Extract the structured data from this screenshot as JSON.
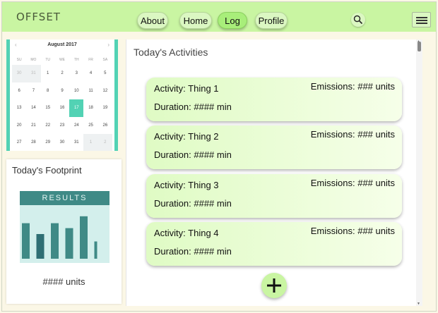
{
  "app": {
    "brand": "OFFSET"
  },
  "nav": {
    "about": "About",
    "home": "Home",
    "log": "Log",
    "profile": "Profile"
  },
  "calendar": {
    "month_label": "August 2017",
    "weekdays": [
      "SU",
      "MO",
      "TU",
      "WE",
      "TH",
      "FR",
      "SA"
    ],
    "weeks": [
      [
        "30",
        "31",
        "1",
        "2",
        "3",
        "4",
        "5"
      ],
      [
        "6",
        "7",
        "8",
        "9",
        "10",
        "11",
        "12"
      ],
      [
        "13",
        "14",
        "15",
        "16",
        "17",
        "18",
        "19"
      ],
      [
        "20",
        "21",
        "22",
        "23",
        "24",
        "25",
        "26"
      ],
      [
        "27",
        "28",
        "29",
        "30",
        "31",
        "1",
        "2"
      ]
    ],
    "selected_day": "17"
  },
  "footprint": {
    "title": "Today's Footprint",
    "results_label": "RESULTS",
    "units_label": "#### units",
    "bar_levels": [
      0.72,
      0.5,
      0.72,
      0.62,
      0.86,
      0.35
    ]
  },
  "activities": {
    "title": "Today's Activities",
    "items": [
      {
        "name": "Activity: Thing 1",
        "emissions": "Emissions: ### units",
        "duration": "Duration: #### min"
      },
      {
        "name": "Activity: Thing 2",
        "emissions": "Emissions: ### units",
        "duration": "Duration: #### min"
      },
      {
        "name": "Activity: Thing 3",
        "emissions": "Emissions: ### units",
        "duration": "Duration: #### min"
      },
      {
        "name": "Activity: Thing 4",
        "emissions": "Emissions: ### units",
        "duration": "Duration: #### min"
      }
    ]
  },
  "icons": {
    "search": "search-icon",
    "menu": "hamburger-menu-icon",
    "add": "plus-icon"
  },
  "colors": {
    "nav_bg": "#c9f5a2",
    "accent": "#52d2b4",
    "results_bar": "#3f8a86"
  }
}
